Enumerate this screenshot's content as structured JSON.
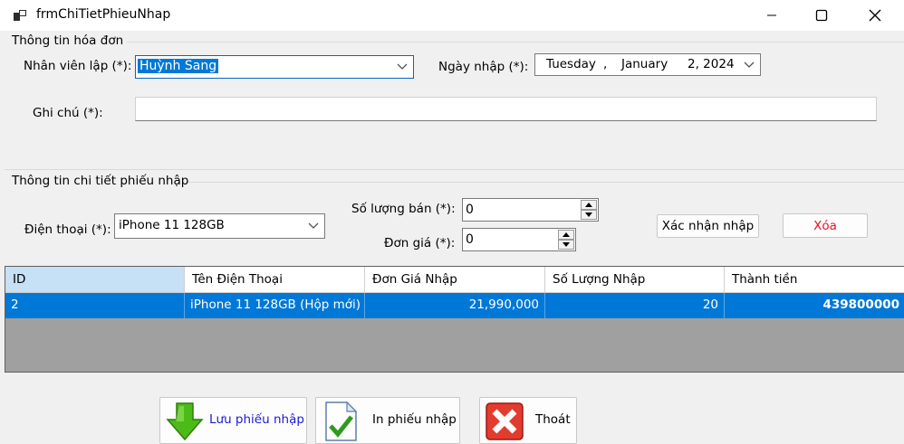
{
  "window": {
    "title": "frmChiTietPhieuNhap"
  },
  "invoice_group": {
    "title": "Thông tin hóa đơn",
    "employee_label": "Nhân viên lập (*):",
    "employee_value": "Huỳnh Sang",
    "date_label": "Ngày nhập (*):",
    "date_weekday": "Tuesday",
    "date_sep": ",",
    "date_month": "January",
    "date_day_year": "2, 2024",
    "note_label": "Ghi chú (*):",
    "note_value": ""
  },
  "detail_group": {
    "title": "Thông tin chi tiết phiếu nhập",
    "phone_label": "Điện thoại (*):",
    "phone_value": "iPhone 11 128GB",
    "qty_label": "Số lượng bán (*):",
    "qty_value": "0",
    "price_label": "Đơn giá (*):",
    "price_value": "0",
    "confirm_button": "Xác nhận nhập",
    "delete_button": "Xóa"
  },
  "grid": {
    "columns": [
      "ID",
      "Tên Điện Thoại",
      "Đơn Giá Nhập",
      "Số Lượng Nhập",
      "Thành tiền"
    ],
    "rows": [
      {
        "id": "2",
        "name": "iPhone 11 128GB (Hộp mới)",
        "price": "21,990,000",
        "qty": "20",
        "total": "439800000"
      }
    ]
  },
  "actions": {
    "save_label": "Lưu phiếu nhập",
    "print_label": "In phiếu nhập",
    "exit_label": "Thoát"
  },
  "colors": {
    "selection": "#0078d7",
    "delete_text": "#e81123",
    "save_text": "#1a1ad8"
  }
}
